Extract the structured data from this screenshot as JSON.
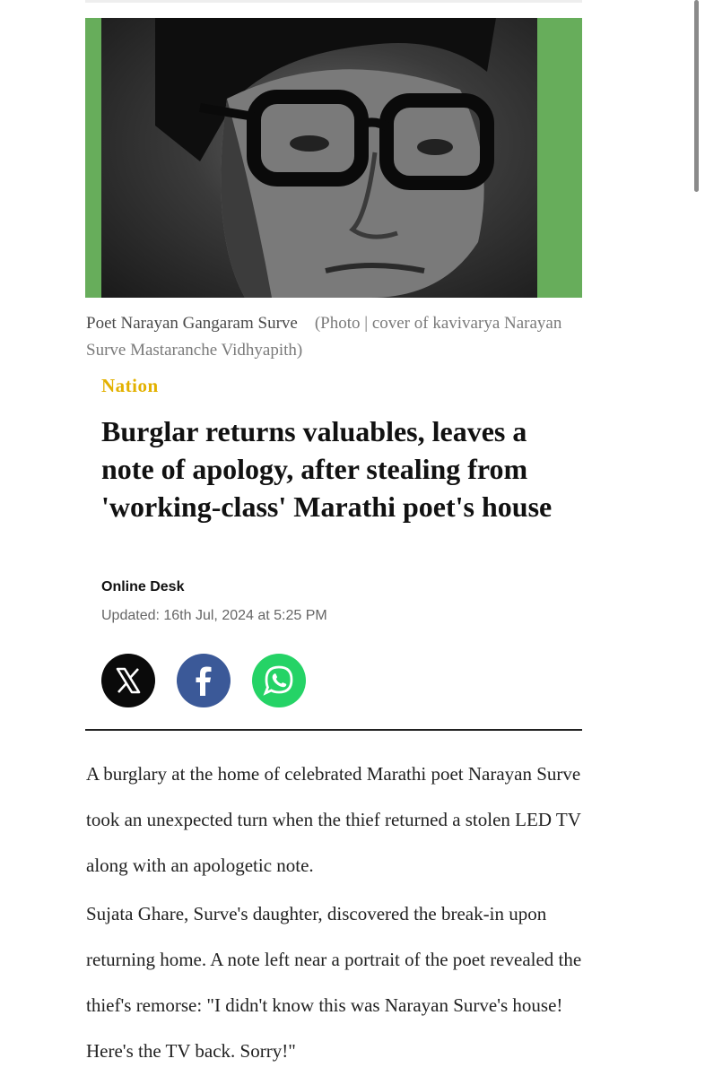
{
  "image": {
    "caption_subject": "Poet Narayan Gangaram Surve",
    "caption_credit": "(Photo | cover of kavivarya Narayan Surve Mastaranche Vidhyapith)",
    "colors": {
      "frame": "#67ad5b"
    }
  },
  "article": {
    "category": "Nation",
    "headline": "Burglar returns valuables, leaves a note of apology, after stealing from 'working-class' Marathi poet's house",
    "author": "Online Desk",
    "updated": "Updated: 16th Jul, 2024 at 5:25 PM",
    "paragraphs": [
      "A burglary at the home of celebrated Marathi poet Narayan Surve took an unexpected turn when the thief returned a stolen LED TV along with an apologetic note.",
      "Sujata Ghare, Surve's daughter, discovered the break-in upon returning home. A note left near a portrait of the poet revealed the thief's remorse: \"I didn't know this was Narayan Surve's house! Here's the TV back. Sorry!\""
    ]
  },
  "share": {
    "icons": [
      "x-icon",
      "facebook-icon",
      "whatsapp-icon"
    ],
    "colors": {
      "x": "#0a0a0a",
      "facebook": "#3b5998",
      "whatsapp": "#25d366"
    }
  },
  "colors": {
    "category": "#e3b100",
    "text": "#111111",
    "muted": "#666666"
  }
}
